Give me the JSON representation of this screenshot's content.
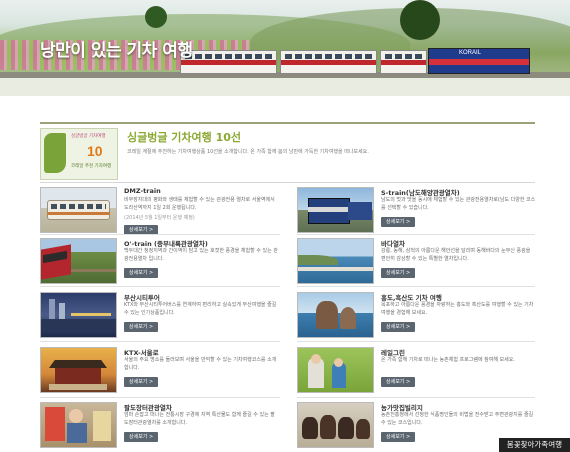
{
  "hero": {
    "title": "낭만이 있는 기차 여행",
    "locomotive_logo": "KORAIL"
  },
  "intro": {
    "title": "싱글벙글 기차여행 10선",
    "description": "코레일 계절에 추천하는 기차여행상품 10선을 소개합니다. 온 가족 함께 봄의 낭만에 가득한 기차여행을 떠나보세요.",
    "badge_number": "10",
    "badge_small_top": "싱글벙글 기차여행",
    "badge_small_bottom": "코레일 추천 기차여행"
  },
  "cards": [
    {
      "name": "DMZ-train",
      "desc": "비무장지대의 평화와 생태를 체험할 수 있는 관광전용 열차로 서울역에서 도라산역까지 1일 2회 운행됩니다.",
      "note": "(2014년 5월 1일부터 운행 예정)",
      "more": "상세보기 >"
    },
    {
      "name": "S-train(남도해양관광열차)",
      "desc": "남도의 멋과 맛을 동시에 체험할 수 있는 관광전용열차로(남도 다양한 코스를 선택할 수 있습니다.",
      "note": "",
      "more": "상세보기 >"
    },
    {
      "name": "O'-train (중부내륙관광열차)",
      "desc": "백두대간 청정지역과 간이역이 담고 있는 호젓한 풍경을 체험할 수 있는 관광전용열차 입니다.",
      "note": "",
      "more": "상세보기 >"
    },
    {
      "name": "바다열차",
      "desc": "강릉, 동해, 삼척의 아름다운 해안선을 달리며 동해바다의 눈부신 풍광을 편안히 감상할 수 있는 특별한 열차입니다.",
      "note": "",
      "more": "상세보기 >"
    },
    {
      "name": "부산시티투어",
      "desc": "KTX와 부산시티투어버스를 연계하여 편리하고 실속있게 부산여행을 즐길 수 있는 인기상품입니다.",
      "note": "",
      "more": "상세보기 >"
    },
    {
      "name": "홍도,흑산도 기차 여행",
      "desc": "목포하고 아름다운 풍경을 자랑하는 홍도와 흑산도를 여행할 수 있는 기차여행을 경험해 보세요.",
      "note": "",
      "more": "상세보기 >"
    },
    {
      "name": "KTX-서울로",
      "desc": "서울의 주요 명소를 둘러보며 서울을 만끽할 수 있는 기차여행코스를 소개합니다.",
      "note": "",
      "more": "상세보기 >"
    },
    {
      "name": "레일그린",
      "desc": "온 가족 함께 기차로 떠나는 농촌체험 프로그램에 참여해 보세요.",
      "note": "",
      "more": "상세보기 >"
    },
    {
      "name": "팔도장터관광열차",
      "desc": "엄마 손잡고 떠나는 전통시장 구경에 지역 특산물도 함께 즐길 수 있는 팔도장터관광열차를 소개합니다.",
      "note": "",
      "more": "상세보기 >"
    },
    {
      "name": "농가맛집빌리지",
      "desc": "농촌진흥청에서 선정한 식품명인들의 비법을 전수받고 주변관광지를 즐길 수 있는 코스입니다.",
      "note": "",
      "more": "상세보기 >"
    }
  ],
  "footer_tag": "봄꽃찾아가족여행",
  "colors": {
    "intro_title": "#8aa832",
    "button_bg": "#5a6570",
    "locomotive": "#1f3b8c",
    "stripe": "#c0272d"
  }
}
